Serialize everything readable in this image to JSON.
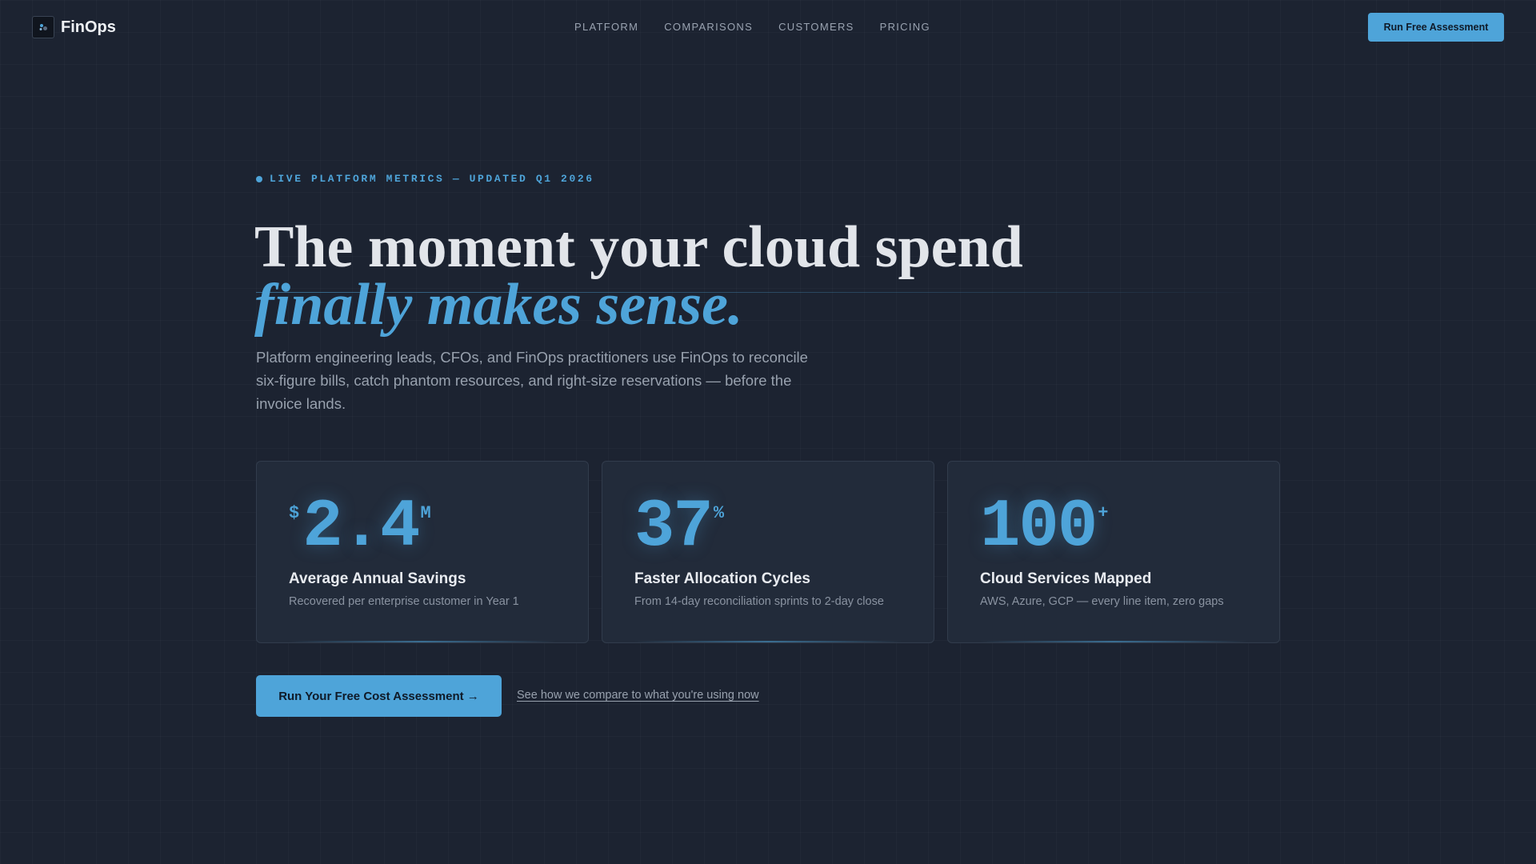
{
  "nav": {
    "brand": "FinOps",
    "logo_icon": "finops-logo-icon",
    "links": [
      "PLATFORM",
      "COMPARISONS",
      "CUSTOMERS",
      "PRICING"
    ],
    "cta_label": "Run Free Assessment"
  },
  "hero": {
    "eyebrow": "LIVE PLATFORM METRICS — UPDATED Q1 2026",
    "headline_line1": "The moment your cloud spend",
    "headline_line2": "finally makes sense.",
    "subhead": "Platform engineering leads, CFOs, and FinOps practitioners use FinOps to reconcile six-figure bills, catch phantom resources, and right-size reservations — before the invoice lands."
  },
  "stats": [
    {
      "prefix": "$",
      "value": "2.4",
      "suffix": "M",
      "title": "Average Annual Savings",
      "description": "Recovered per enterprise customer in Year 1"
    },
    {
      "prefix": "",
      "value": "37",
      "suffix": "%",
      "title": "Faster Allocation Cycles",
      "description": "From 14-day reconciliation sprints to 2-day close"
    },
    {
      "prefix": "",
      "value": "100",
      "suffix": "+",
      "title": "Cloud Services Mapped",
      "description": "AWS, Azure, GCP — every line item, zero gaps"
    }
  ],
  "cta": {
    "primary_label": "Run Your Free Cost Assessment →",
    "secondary_label": "See how we compare to what you're using now"
  },
  "colors": {
    "background": "#1c2331",
    "accent": "#4ea4d9",
    "card": "#222b3a"
  }
}
